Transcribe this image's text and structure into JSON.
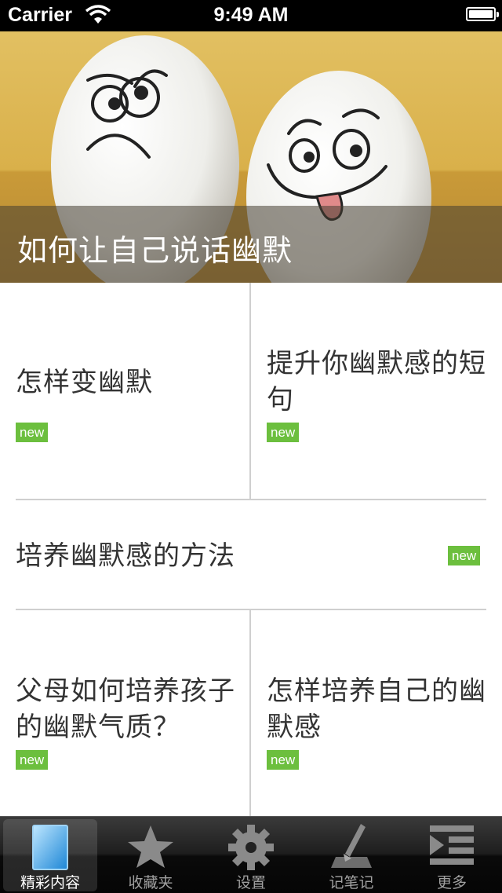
{
  "status_bar": {
    "carrier": "Carrier",
    "time": "9:49 AM"
  },
  "hero": {
    "title": "如何让自己说话幽默"
  },
  "articles": [
    {
      "title": "怎样变幽默",
      "badge": "new"
    },
    {
      "title": "提升你幽默感的短句",
      "badge": "new"
    },
    {
      "title": "培养幽默感的方法",
      "badge": "new"
    },
    {
      "title": "父母如何培养孩子的幽默气质？",
      "badge": "new"
    },
    {
      "title": "怎样培养自己的幽默感",
      "badge": "new"
    }
  ],
  "tabs": [
    {
      "label": "精彩内容",
      "icon": "content-icon",
      "active": true
    },
    {
      "label": "收藏夹",
      "icon": "star-icon",
      "active": false
    },
    {
      "label": "设置",
      "icon": "gear-icon",
      "active": false
    },
    {
      "label": "记笔记",
      "icon": "pen-icon",
      "active": false
    },
    {
      "label": "更多",
      "icon": "more-list-icon",
      "active": false
    }
  ],
  "colors": {
    "badge": "#6cbf3e",
    "tab_active_icon": "#2a9be0"
  }
}
